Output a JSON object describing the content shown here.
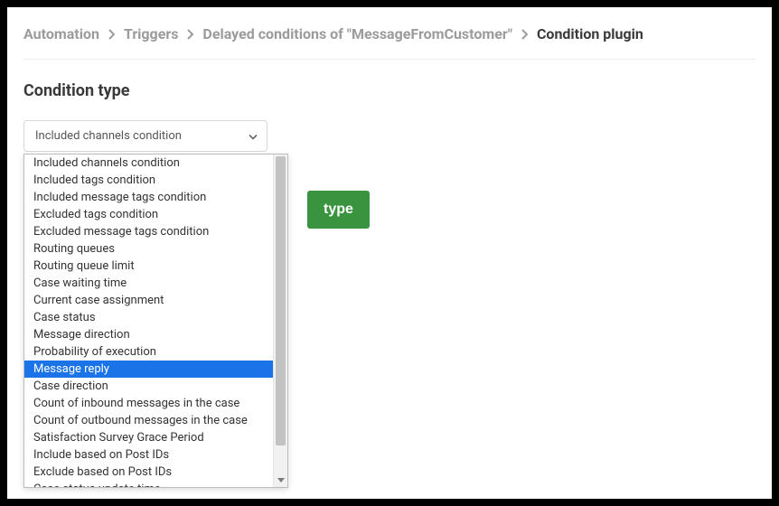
{
  "breadcrumb": {
    "items": [
      {
        "label": "Automation",
        "active": false
      },
      {
        "label": "Triggers",
        "active": false
      },
      {
        "label": "Delayed conditions of \"MessageFromCustomer\"",
        "active": false
      },
      {
        "label": "Condition plugin",
        "active": true
      }
    ]
  },
  "section": {
    "title": "Condition type"
  },
  "select": {
    "selected_label": "Included channels condition",
    "options": [
      "Included channels condition",
      "Included tags condition",
      "Included message tags condition",
      "Excluded tags condition",
      "Excluded message tags condition",
      "Routing queues",
      "Routing queue limit",
      "Case waiting time",
      "Current case assignment",
      "Case status",
      "Message direction",
      "Probability of execution",
      "Message reply",
      "Case direction",
      "Count of inbound messages in the case",
      "Count of outbound messages in the case",
      "Satisfaction Survey Grace Period",
      "Include based on Post IDs",
      "Exclude based on Post IDs",
      "Case status update time"
    ],
    "highlighted_index": 12
  },
  "actions": {
    "submit_label": "type"
  },
  "colors": {
    "primary_button": "#3a933e",
    "highlight": "#1a74e8"
  }
}
